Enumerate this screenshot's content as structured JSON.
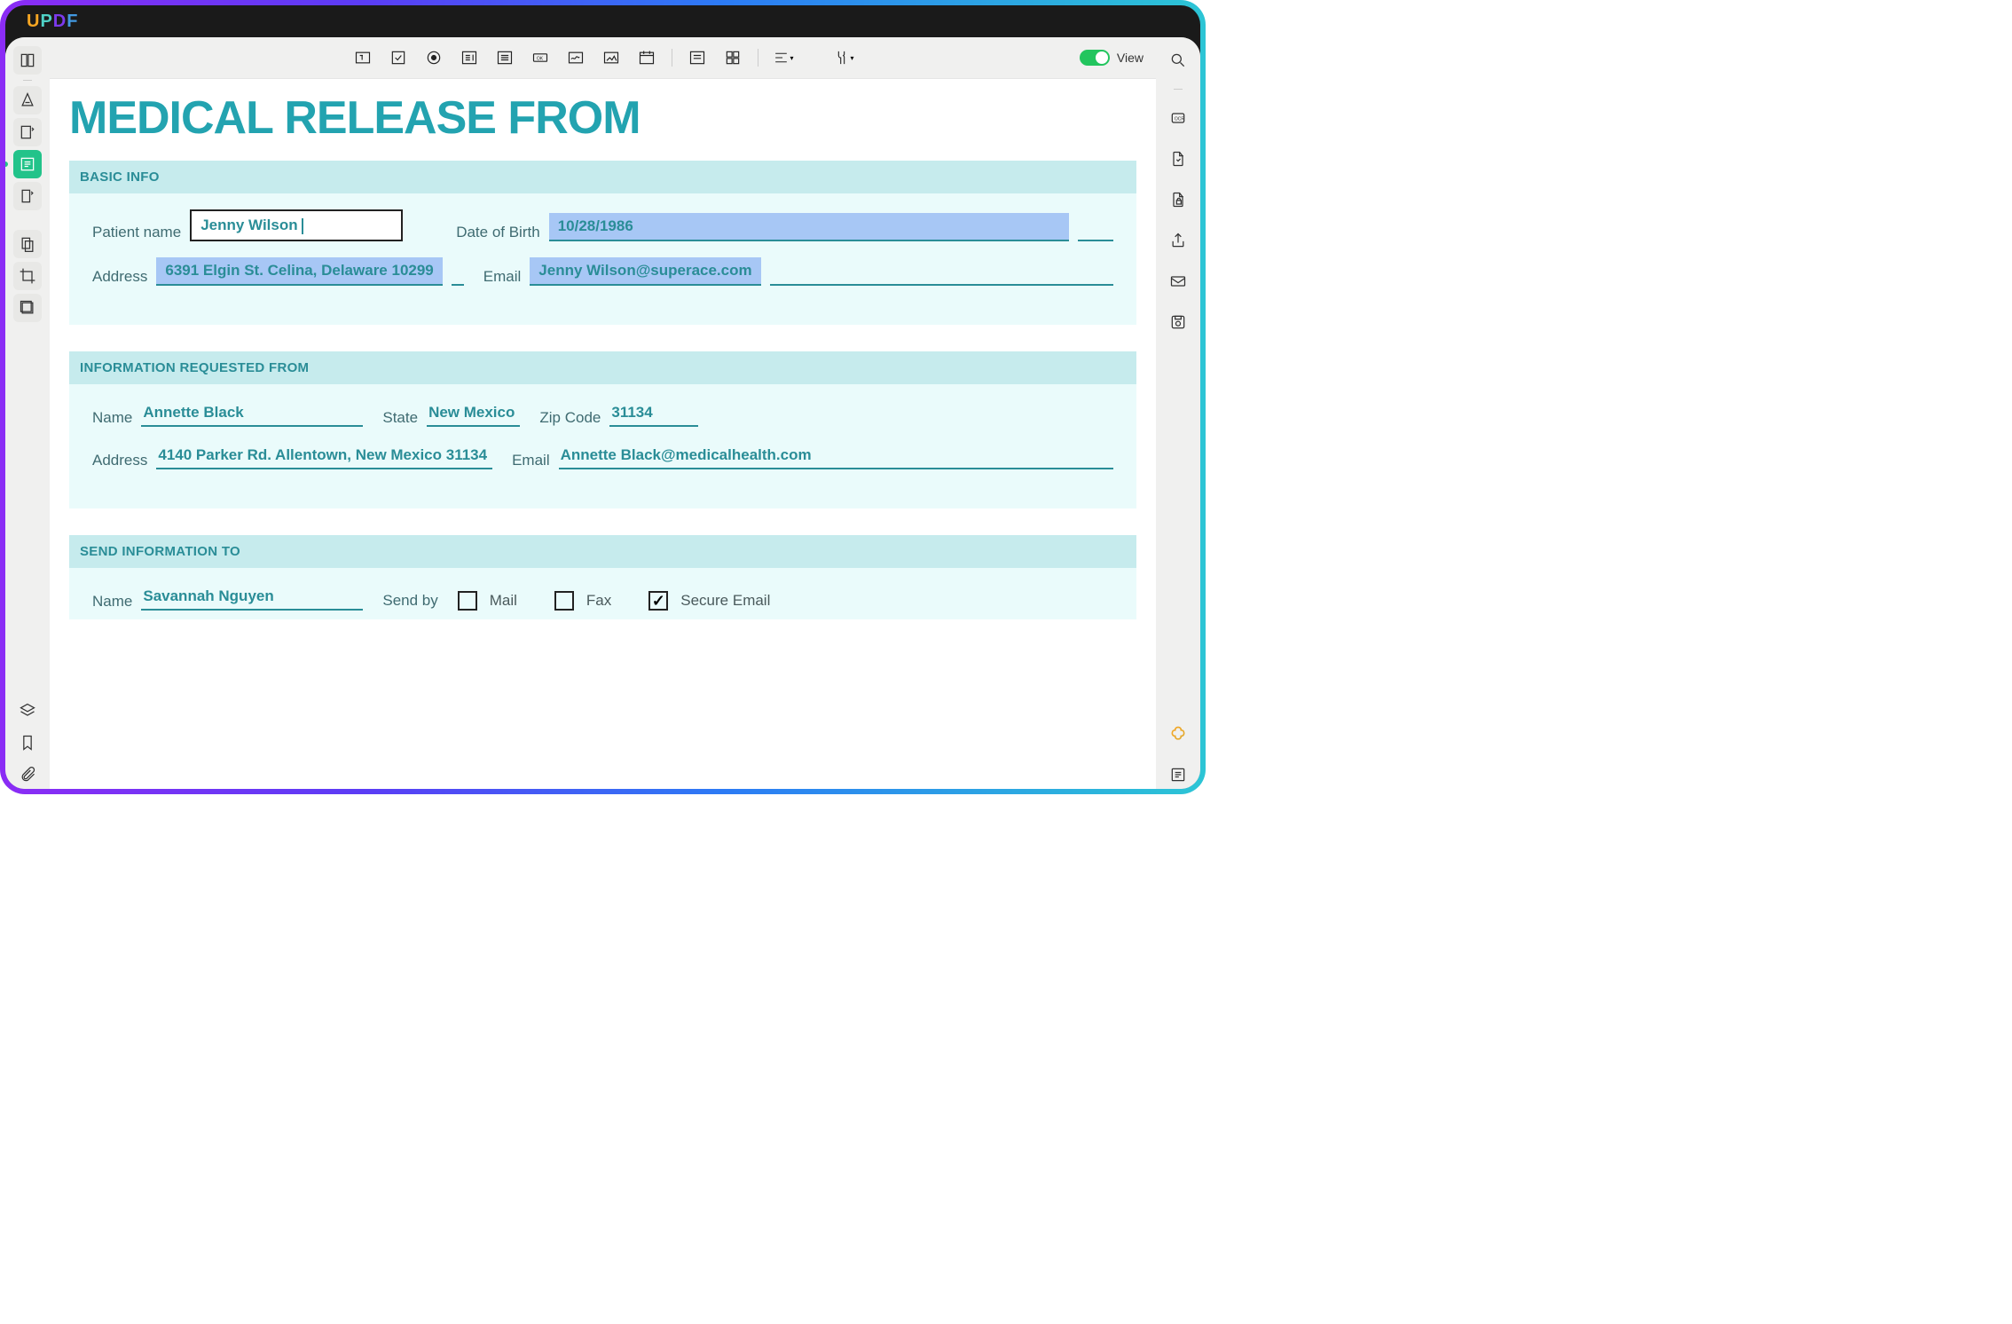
{
  "logo": {
    "u": "U",
    "p": "P",
    "d": "D",
    "f": "F"
  },
  "toolbar": {
    "view_label": "View"
  },
  "document": {
    "title": "MEDICAL RELEASE FROM",
    "sections": {
      "basic": {
        "header": "BASIC INFO",
        "patient_label": "Patient name",
        "patient_value": "Jenny Wilson",
        "dob_label": "Date of Birth",
        "dob_value": "10/28/1986",
        "address_label": "Address",
        "address_value": "6391 Elgin St. Celina, Delaware 10299",
        "email_label": "Email",
        "email_value": "Jenny Wilson@superace.com"
      },
      "requested": {
        "header": "INFORMATION REQUESTED FROM",
        "name_label": "Name",
        "name_value": "Annette Black",
        "state_label": "State",
        "state_value": "New Mexico",
        "zip_label": "Zip Code",
        "zip_value": "31134",
        "address_label": "Address",
        "address_value": "4140 Parker Rd. Allentown, New Mexico 31134",
        "email_label": "Email",
        "email_value": "Annette Black@medicalhealth.com"
      },
      "send": {
        "header": "SEND INFORMATION TO",
        "name_label": "Name",
        "name_value": "Savannah Nguyen",
        "sendby_label": "Send by",
        "mail_label": "Mail",
        "fax_label": "Fax",
        "secure_label": "Secure Email"
      }
    }
  }
}
